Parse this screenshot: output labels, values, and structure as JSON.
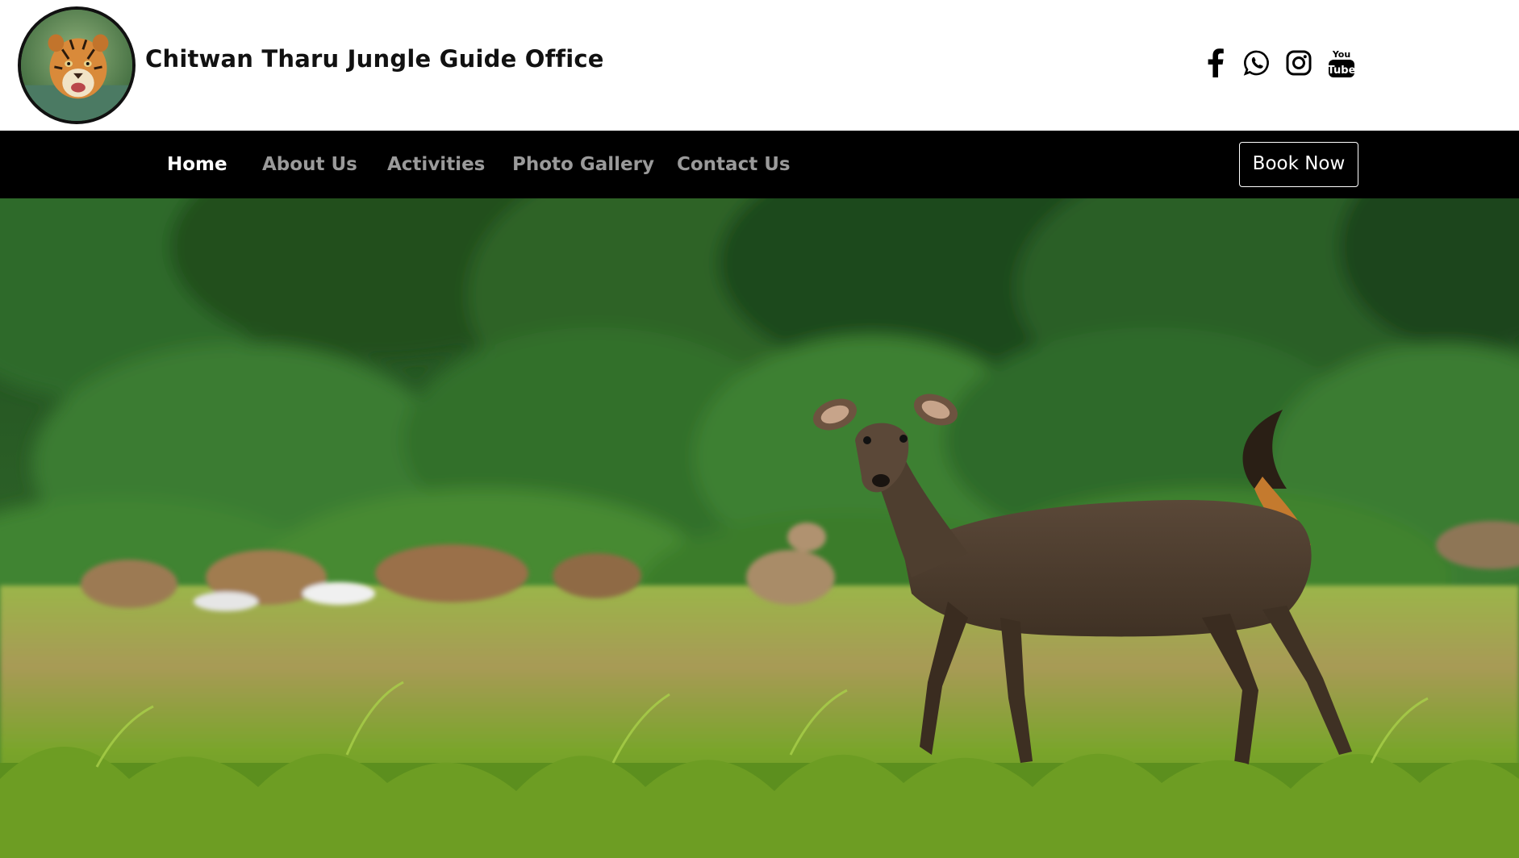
{
  "site": {
    "title": "Chitwan Tharu Jungle Guide Office",
    "logo_icon": "tiger-logo"
  },
  "social": [
    {
      "name": "facebook",
      "icon": "facebook-icon"
    },
    {
      "name": "whatsapp",
      "icon": "whatsapp-icon"
    },
    {
      "name": "instagram",
      "icon": "instagram-icon"
    },
    {
      "name": "youtube",
      "icon": "youtube-icon",
      "text_top": "You",
      "text_bottom": "Tube"
    }
  ],
  "nav": {
    "items": [
      {
        "label": "Home",
        "active": true
      },
      {
        "label": "About Us",
        "active": false
      },
      {
        "label": "Activities",
        "active": false
      },
      {
        "label": "Photo Gallery",
        "active": false
      },
      {
        "label": "Contact Us",
        "active": false
      }
    ],
    "book_label": "Book Now"
  },
  "hero": {
    "image": "jungle-deer-photo"
  },
  "colors": {
    "header_bg": "#ffffff",
    "nav_bg": "#000000",
    "nav_active": "#ffffff",
    "nav_inactive": "#9a9a9a",
    "forest_dark": "#1d4a1c",
    "grass": "#7fa62c"
  }
}
